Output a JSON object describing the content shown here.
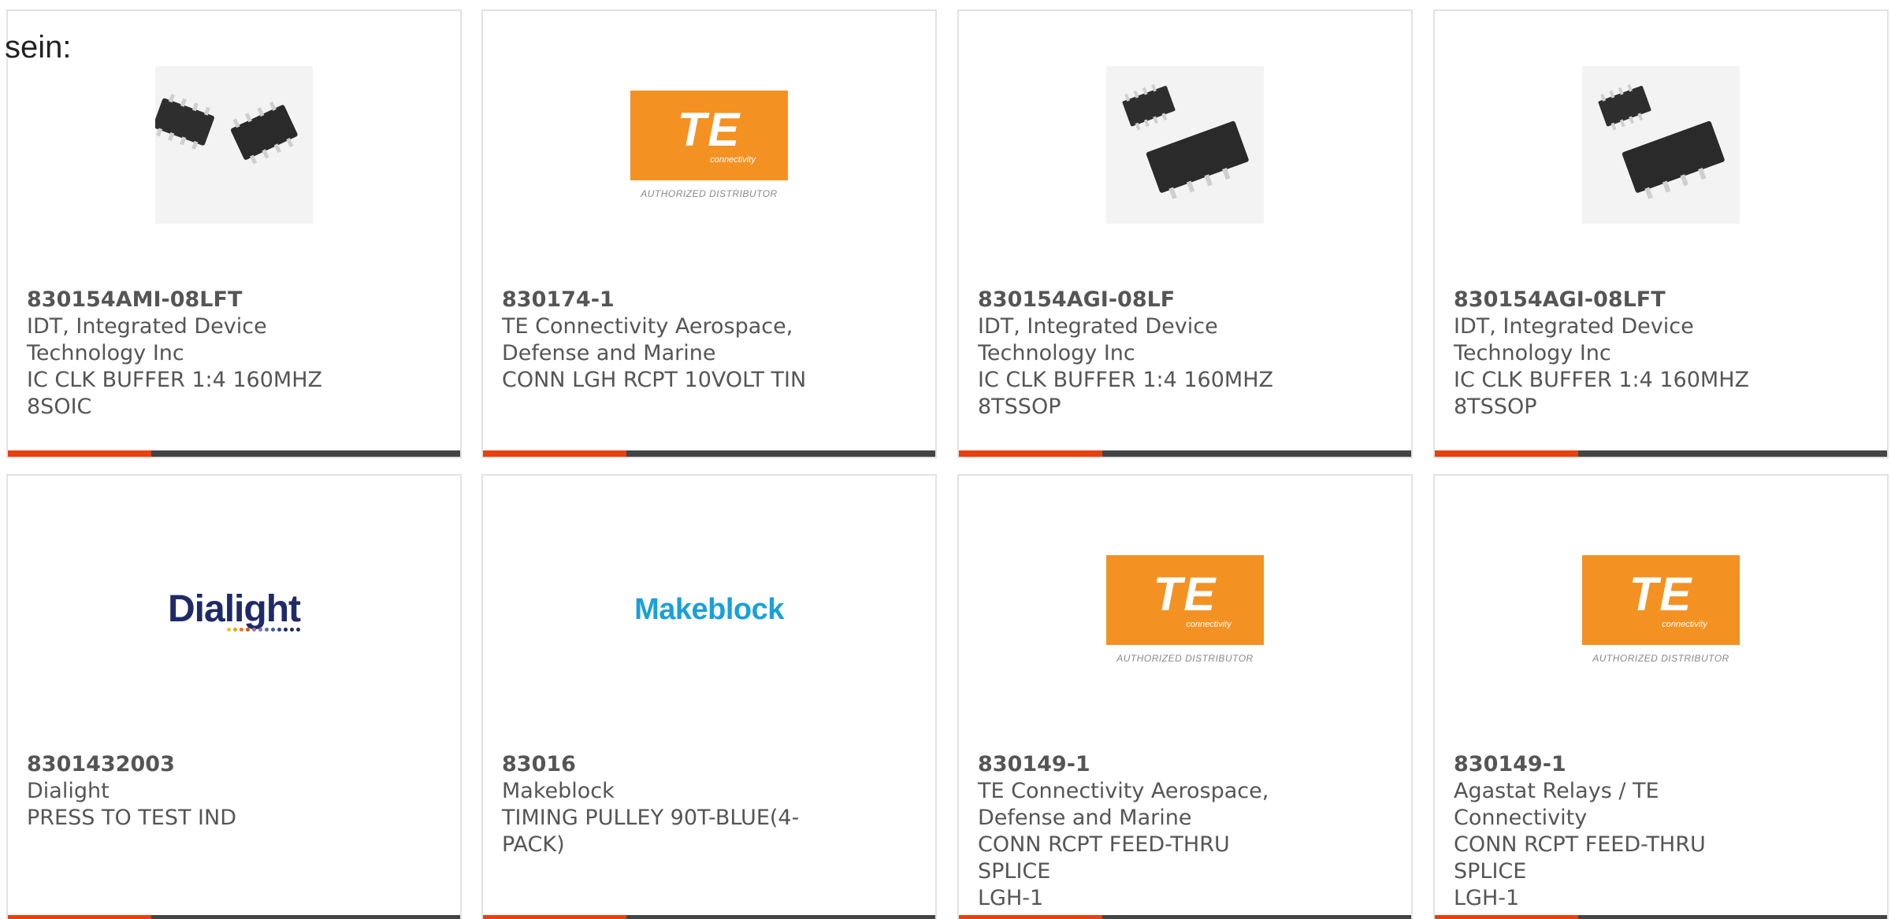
{
  "intro_text": "sein:",
  "brand_colors": {
    "accent": "#e8400e",
    "bar": "#444444",
    "te_orange": "#f39222",
    "dialight_blue": "#1f2a66"
  },
  "products": [
    {
      "part_number": "830154AMI-08LFT",
      "manufacturer_line1": "IDT, Integrated Device",
      "manufacturer_line2": "Technology Inc",
      "description_line1": "IC CLK BUFFER 1:4 160MHZ",
      "description_line2": "8SOIC",
      "image": "soic-chip-photo"
    },
    {
      "part_number": "830174-1",
      "manufacturer_line1": "TE Connectivity Aerospace,",
      "manufacturer_line2": "Defense and Marine",
      "description_line1": "CONN LGH RCPT 10VOLT TIN",
      "description_line2": "",
      "image": "te-logo"
    },
    {
      "part_number": "830154AGI-08LF",
      "manufacturer_line1": "IDT, Integrated Device",
      "manufacturer_line2": "Technology Inc",
      "description_line1": "IC CLK BUFFER 1:4 160MHZ",
      "description_line2": "8TSSOP",
      "image": "tssop-chip-photo"
    },
    {
      "part_number": "830154AGI-08LFT",
      "manufacturer_line1": "IDT, Integrated Device",
      "manufacturer_line2": "Technology Inc",
      "description_line1": "IC CLK BUFFER 1:4 160MHZ",
      "description_line2": "8TSSOP",
      "image": "tssop-chip-photo"
    },
    {
      "part_number": "8301432003",
      "manufacturer_line1": "Dialight",
      "manufacturer_line2": "",
      "description_line1": "PRESS TO TEST IND",
      "description_line2": "",
      "image": "dialight-logo"
    },
    {
      "part_number": "83016",
      "manufacturer_line1": "Makeblock",
      "manufacturer_line2": "",
      "description_line1": "TIMING PULLEY 90T-BLUE(4-",
      "description_line2": "PACK)",
      "image": "makeblock-logo"
    },
    {
      "part_number": "830149-1",
      "manufacturer_line1": "TE Connectivity Aerospace,",
      "manufacturer_line2": "Defense and Marine",
      "description_line1": "CONN RCPT FEED-THRU SPLICE",
      "description_line2": "LGH-1",
      "image": "te-logo"
    },
    {
      "part_number": "830149-1",
      "manufacturer_line1": "Agastat Relays / TE Connectivity",
      "manufacturer_line2": "",
      "description_line1": "CONN RCPT FEED-THRU SPLICE",
      "description_line2": "LGH-1",
      "image": "te-logo"
    }
  ],
  "logos": {
    "te_mark": "TE",
    "te_sub": "connectivity",
    "te_authorized": "AUTHORIZED DISTRIBUTOR",
    "dialight": "Dialight",
    "makeblock": "Makeblock"
  }
}
